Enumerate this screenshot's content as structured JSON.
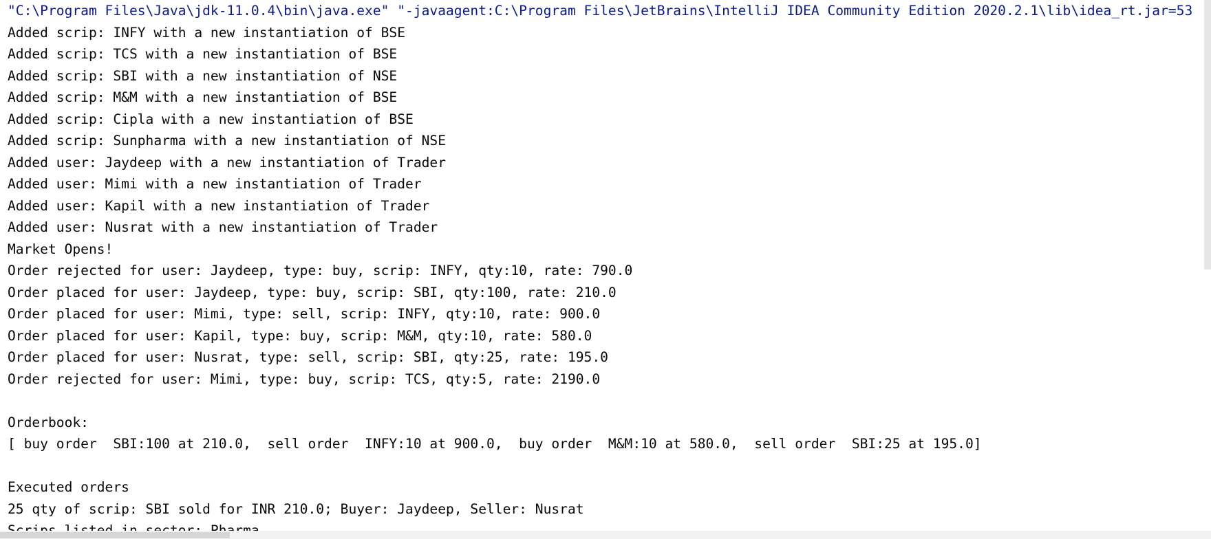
{
  "console": {
    "command": "\"C:\\Program Files\\Java\\jdk-11.0.4\\bin\\java.exe\" \"-javaagent:C:\\Program Files\\JetBrains\\IntelliJ IDEA Community Edition 2020.2.1\\lib\\idea_rt.jar=53",
    "lines": [
      "Added scrip: INFY with a new instantiation of BSE",
      "Added scrip: TCS with a new instantiation of BSE",
      "Added scrip: SBI with a new instantiation of NSE",
      "Added scrip: M&M with a new instantiation of BSE",
      "Added scrip: Cipla with a new instantiation of BSE",
      "Added scrip: Sunpharma with a new instantiation of NSE",
      "Added user: Jaydeep with a new instantiation of Trader",
      "Added user: Mimi with a new instantiation of Trader",
      "Added user: Kapil with a new instantiation of Trader",
      "Added user: Nusrat with a new instantiation of Trader",
      "Market Opens!",
      "Order rejected for user: Jaydeep, type: buy, scrip: INFY, qty:10, rate: 790.0",
      "Order placed for user: Jaydeep, type: buy, scrip: SBI, qty:100, rate: 210.0",
      "Order placed for user: Mimi, type: sell, scrip: INFY, qty:10, rate: 900.0",
      "Order placed for user: Kapil, type: buy, scrip: M&M, qty:10, rate: 580.0",
      "Order placed for user: Nusrat, type: sell, scrip: SBI, qty:25, rate: 195.0",
      "Order rejected for user: Mimi, type: buy, scrip: TCS, qty:5, rate: 2190.0",
      "",
      "Orderbook:",
      "[ buy order  SBI:100 at 210.0,  sell order  INFY:10 at 900.0,  buy order  M&M:10 at 580.0,  sell order  SBI:25 at 195.0]",
      "",
      "Executed orders",
      "25 qty of scrip: SBI sold for INR 210.0; Buyer: Jaydeep, Seller: Nusrat",
      "Scrips listed in sector: Pharma"
    ]
  },
  "colors": {
    "command_text": "#0a1a8c",
    "output_text": "#080808",
    "background": "#ffffff"
  }
}
